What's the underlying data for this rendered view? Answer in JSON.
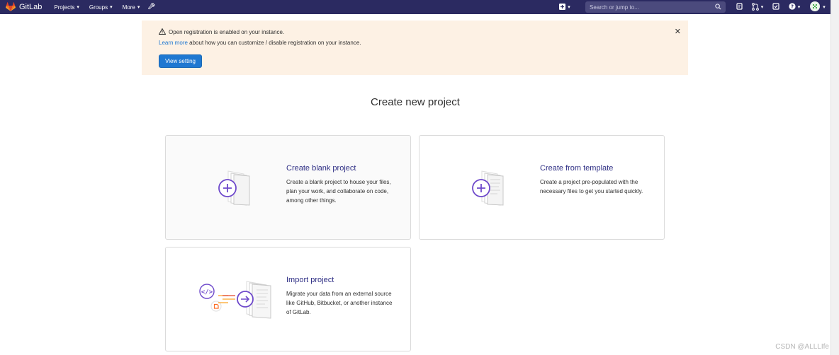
{
  "navbar": {
    "brand": "GitLab",
    "items": [
      {
        "label": "Projects"
      },
      {
        "label": "Groups"
      },
      {
        "label": "More"
      }
    ],
    "search_placeholder": "Search or jump to..."
  },
  "alert": {
    "title": "Open registration is enabled on your instance.",
    "link_text": "Learn more",
    "body_text": " about how you can customize / disable registration on your instance.",
    "button_label": "View setting"
  },
  "page": {
    "title": "Create new project"
  },
  "cards": [
    {
      "title": "Create blank project",
      "description": "Create a blank project to house your files, plan your work, and collaborate on code, among other things."
    },
    {
      "title": "Create from template",
      "description": "Create a project pre-populated with the necessary files to get you started quickly."
    },
    {
      "title": "Import project",
      "description": "Migrate your data from an external source like GitHub, Bitbucket, or another instance of GitLab."
    }
  ],
  "watermark": "CSDN @ALLLIfe",
  "colors": {
    "navbar_bg": "#2b2a61",
    "alert_bg": "#fdf1e4",
    "primary": "#1f78d1",
    "card_title": "#2e2e84",
    "illustration_purple": "#6e49cb"
  }
}
